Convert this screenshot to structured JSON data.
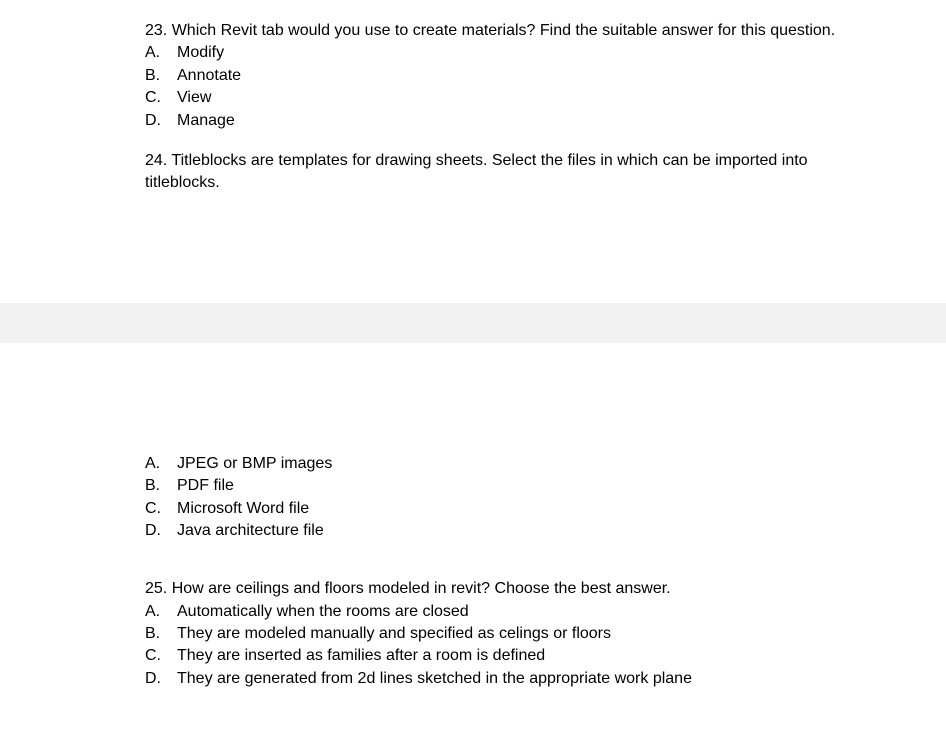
{
  "q23": {
    "question": "23. Which Revit tab would you use to create materials? Find the suitable answer for this question.",
    "options": [
      {
        "letter": "A.",
        "text": "Modify"
      },
      {
        "letter": "B.",
        "text": "Annotate"
      },
      {
        "letter": "C.",
        "text": "View"
      },
      {
        "letter": "D.",
        "text": "Manage"
      }
    ]
  },
  "q24": {
    "question": "24.  Titleblocks are templates for drawing sheets. Select the files in which can be imported into titleblocks.",
    "options": [
      {
        "letter": "A.",
        "text": "JPEG or BMP images"
      },
      {
        "letter": "B.",
        "text": "PDF file"
      },
      {
        "letter": "C.",
        "text": "Microsoft Word file"
      },
      {
        "letter": "D.",
        "text": "Java architecture file"
      }
    ]
  },
  "q25": {
    "question": "25. How are ceilings and floors modeled in revit? Choose the best answer.",
    "options": [
      {
        "letter": "A.",
        "text": "Automatically when the rooms are closed"
      },
      {
        "letter": "B.",
        "text": "They are modeled manually and specified as celings or floors"
      },
      {
        "letter": "C.",
        "text": "They are inserted as families after a room is defined"
      },
      {
        "letter": "D.",
        "text": "They are generated from 2d lines sketched in the appropriate work plane"
      }
    ]
  }
}
